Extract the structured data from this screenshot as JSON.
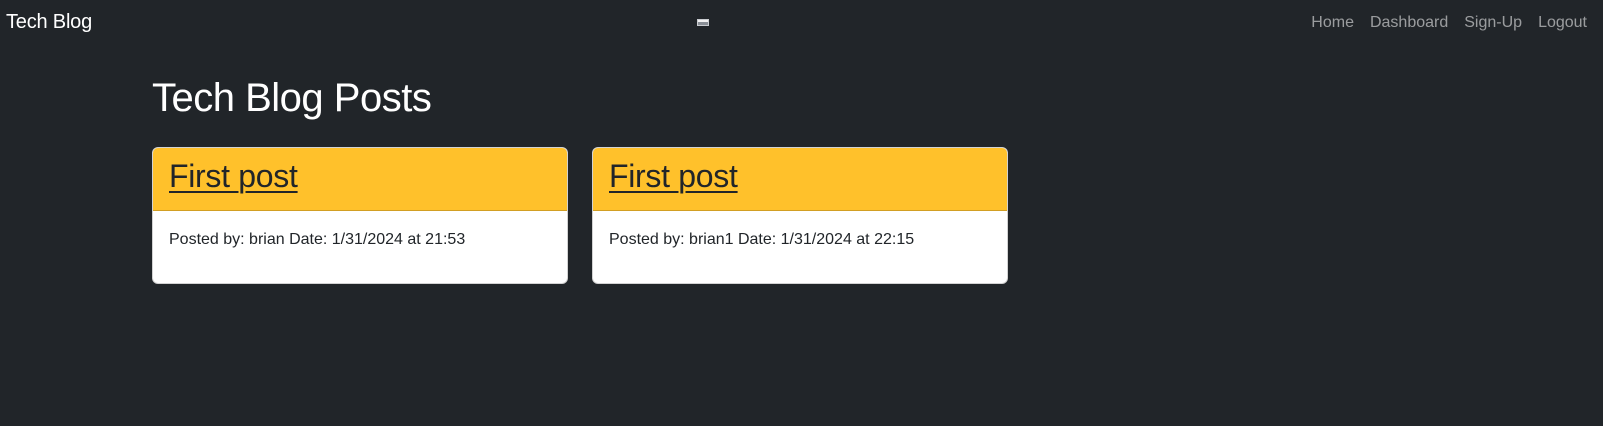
{
  "navbar": {
    "brand": "Tech Blog",
    "links": [
      {
        "label": "Home"
      },
      {
        "label": "Dashboard"
      },
      {
        "label": "Sign-Up"
      },
      {
        "label": "Logout"
      }
    ]
  },
  "main": {
    "title": "Tech Blog Posts",
    "posts": [
      {
        "title": "First post",
        "meta": "Posted by: brian Date: 1/31/2024 at 21:53"
      },
      {
        "title": "First post",
        "meta": "Posted by: brian1 Date: 1/31/2024 at 22:15"
      }
    ]
  },
  "colors": {
    "background": "#212529",
    "card_header": "#ffc12b",
    "nav_link": "#8c8f93"
  }
}
